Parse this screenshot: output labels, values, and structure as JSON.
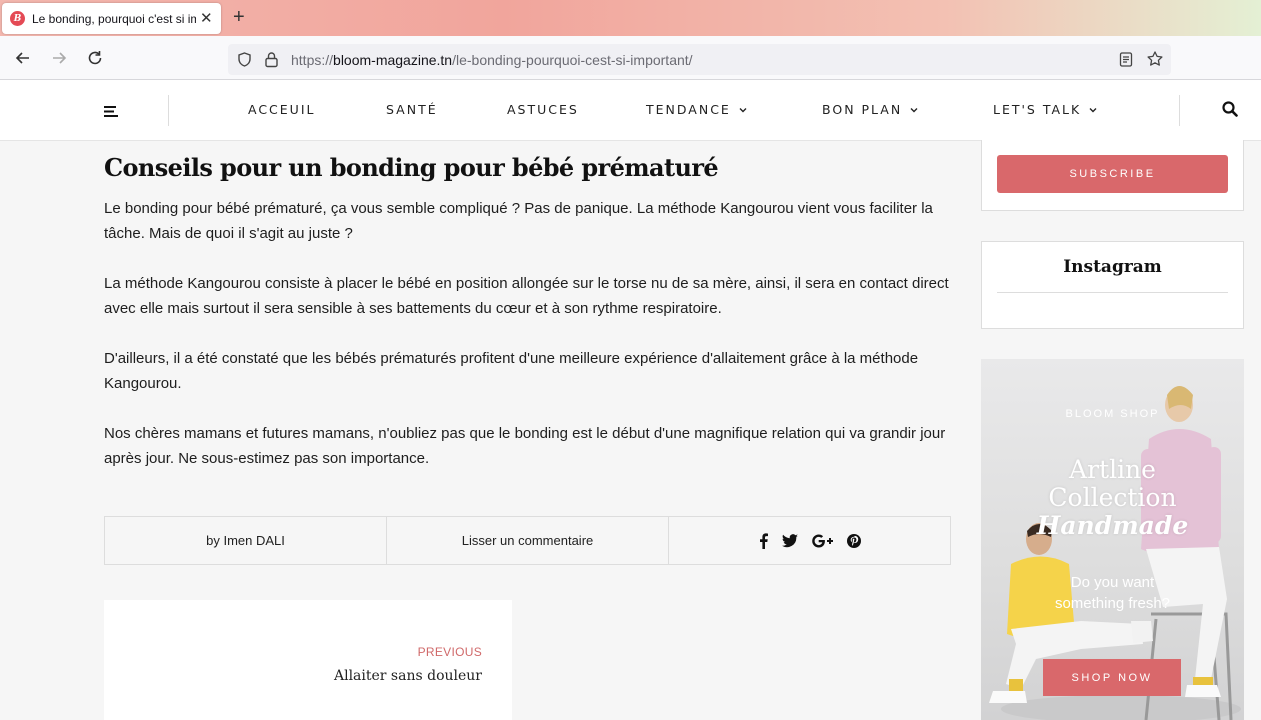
{
  "browser": {
    "tab_title": "Le bonding, pourquoi c'est si im",
    "tab_favicon_letter": "B",
    "url_scheme": "https://",
    "url_host": "bloom-magazine.tn",
    "url_path": "/le-bonding-pourquoi-cest-si-important/"
  },
  "site_nav": {
    "items": [
      {
        "label": "ACCEUIL",
        "dropdown": false
      },
      {
        "label": "SANTÉ",
        "dropdown": false
      },
      {
        "label": "ASTUCES",
        "dropdown": false
      },
      {
        "label": "TENDANCE",
        "dropdown": true
      },
      {
        "label": "BON PLAN",
        "dropdown": true
      },
      {
        "label": "LET'S TALK",
        "dropdown": true
      }
    ]
  },
  "article": {
    "heading": "Conseils pour un bonding pour bébé prématuré",
    "paragraphs": [
      "Le bonding pour bébé prématuré, ça vous semble compliqué ? Pas de panique. La méthode Kangourou vient vous faciliter la tâche. Mais de quoi il s'agit au juste ?",
      "La méthode Kangourou consiste à placer le bébé en position allongée sur le torse nu de sa mère, ainsi, il sera en contact direct avec elle mais surtout il sera sensible à ses battements du cœur et à son rythme respiratoire.",
      "D'ailleurs, il a été constaté que les bébés prématurés profitent d'une meilleure expérience d'allaitement grâce à la méthode Kangourou.",
      "Nos chères mamans et futures mamans, n'oubliez pas que le bonding est le début d'une magnifique relation qui va grandir jour après jour. Ne sous-estimez pas son importance."
    ],
    "author_line": "by Imen DALI",
    "comment_link": "Lisser un commentaire",
    "share_icons": [
      "facebook-icon",
      "twitter-icon",
      "google-plus-icon",
      "pinterest-icon"
    ]
  },
  "prev_post": {
    "label": "PREVIOUS",
    "title": "Allaiter sans douleur"
  },
  "sidebar": {
    "subscribe_label": "SUBSCRIBE",
    "instagram_title": "Instagram",
    "ad": {
      "shop_label": "BLOOM SHOP",
      "title_line1": "Artline",
      "title_line2": "Collection",
      "title_line3": "Handmade",
      "subtitle_line1": "Do you want",
      "subtitle_line2": "something fresh?",
      "button_label": "SHOP NOW"
    }
  },
  "colors": {
    "accent": "#d9686b",
    "page_bg": "#f6f6f6"
  }
}
